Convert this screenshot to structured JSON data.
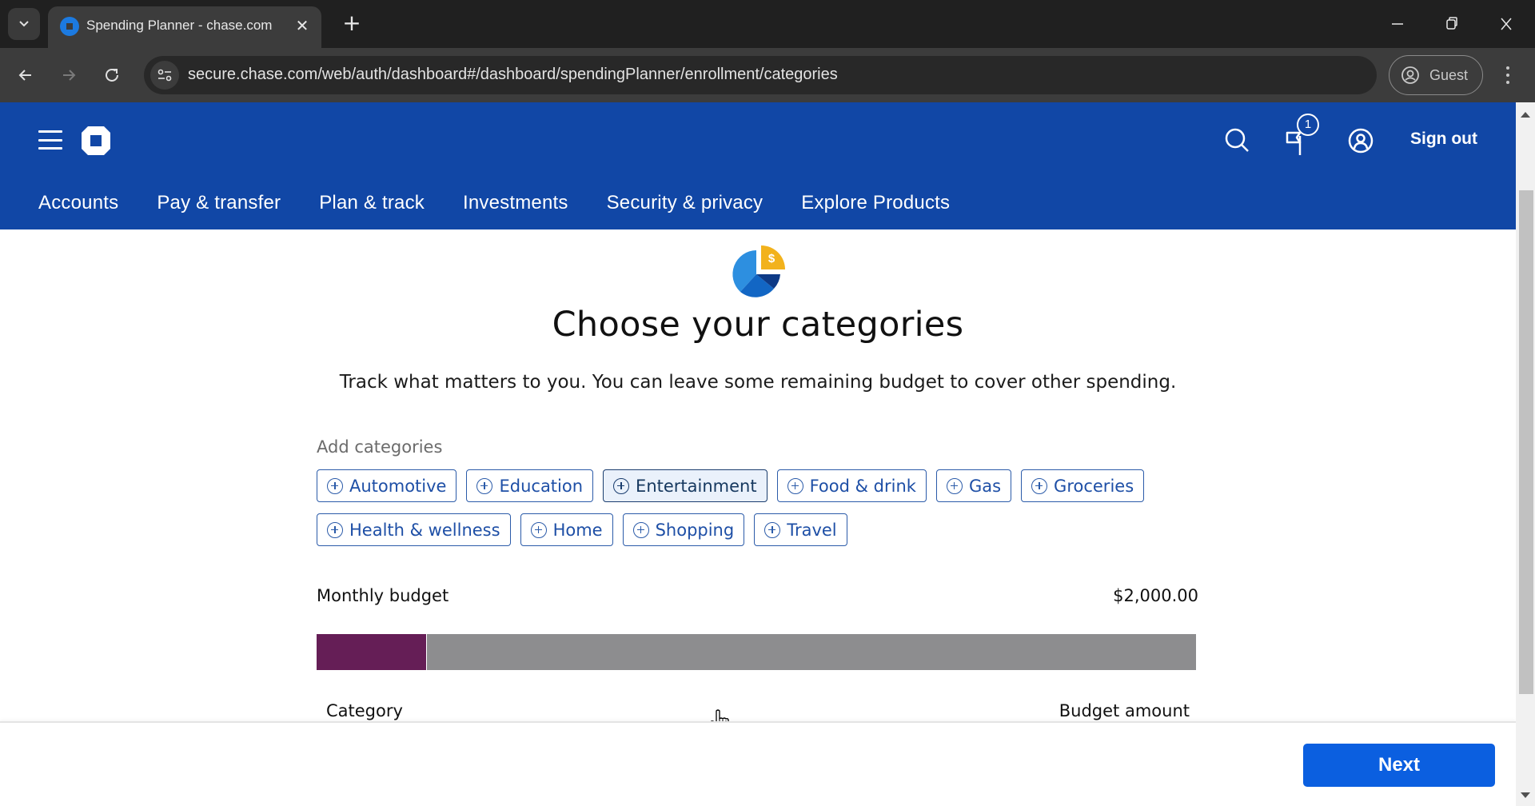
{
  "browser": {
    "tab_title": "Spending Planner - chase.com",
    "url": "secure.chase.com/web/auth/dashboard#/dashboard/spendingPlanner/enrollment/categories",
    "profile_label": "Guest"
  },
  "header": {
    "notification_count": "1",
    "sign_out_label": "Sign out",
    "nav_items": [
      {
        "label": "Accounts"
      },
      {
        "label": "Pay & transfer"
      },
      {
        "label": "Plan & track"
      },
      {
        "label": "Investments"
      },
      {
        "label": "Security & privacy"
      },
      {
        "label": "Explore Products"
      }
    ]
  },
  "main": {
    "title": "Choose your categories",
    "subtitle": "Track what matters to you. You can leave some remaining budget to cover other spending.",
    "add_categories_label": "Add categories",
    "categories": [
      {
        "label": "Automotive"
      },
      {
        "label": "Education"
      },
      {
        "label": "Entertainment",
        "hovered": true
      },
      {
        "label": "Food & drink"
      },
      {
        "label": "Gas"
      },
      {
        "label": "Groceries"
      },
      {
        "label": "Health & wellness"
      },
      {
        "label": "Home"
      },
      {
        "label": "Shopping"
      },
      {
        "label": "Travel"
      }
    ],
    "monthly_budget_label": "Monthly budget",
    "monthly_budget_value": "$2,000.00",
    "budget_allocated_fraction": 0.125,
    "colors": {
      "allocated": "#651e56",
      "remaining": "#8d8d8f",
      "brand": "#1147a6",
      "primary_button": "#0b5fe0"
    },
    "table_headers": {
      "category": "Category",
      "budget_amount": "Budget amount"
    }
  },
  "footer": {
    "next_label": "Next"
  }
}
